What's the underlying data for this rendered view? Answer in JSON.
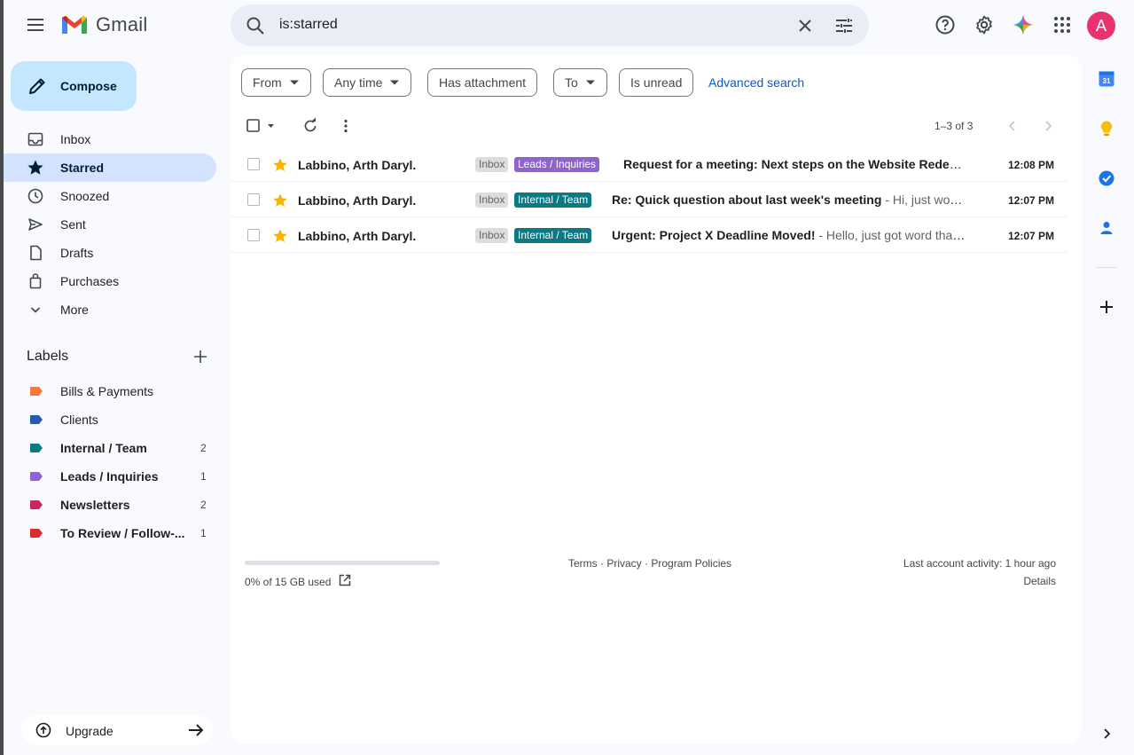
{
  "app": {
    "name": "Gmail"
  },
  "search": {
    "query": "is:starred"
  },
  "colors": {
    "accent": "#0b57d0",
    "compose_bg": "#c2e7ff",
    "active_nav": "#d3e3fd",
    "avatar": "#e8336e"
  },
  "header": {
    "avatar_letter": "A",
    "icons": [
      "help-icon",
      "settings-icon",
      "gemini-icon",
      "apps-icon"
    ]
  },
  "sidebar": {
    "compose_label": "Compose",
    "items": [
      {
        "label": "Inbox",
        "icon": "inbox-icon"
      },
      {
        "label": "Starred",
        "icon": "star-icon",
        "active": true
      },
      {
        "label": "Snoozed",
        "icon": "clock-icon"
      },
      {
        "label": "Sent",
        "icon": "send-icon"
      },
      {
        "label": "Drafts",
        "icon": "draft-icon"
      },
      {
        "label": "Purchases",
        "icon": "shopping-bag-icon"
      },
      {
        "label": "More",
        "icon": "chevron-down-icon"
      }
    ],
    "labels_title": "Labels",
    "labels": [
      {
        "label": "Bills & Payments",
        "color": "#f5793b",
        "count": "",
        "bold": false
      },
      {
        "label": "Clients",
        "color": "#285bac",
        "count": "",
        "bold": false
      },
      {
        "label": "Internal / Team",
        "color": "#0b7a82",
        "count": "2",
        "bold": true
      },
      {
        "label": "Leads / Inquiries",
        "color": "#8e63ce",
        "count": "1",
        "bold": true
      },
      {
        "label": "Newsletters",
        "color": "#c9265f",
        "count": "2",
        "bold": true
      },
      {
        "label": "To Review / Follow-...",
        "color": "#dd2c2c",
        "count": "1",
        "bold": true
      }
    ],
    "upgrade_label": "Upgrade"
  },
  "filters": {
    "chips": [
      {
        "label": "From",
        "dropdown": true
      },
      {
        "label": "Any time",
        "dropdown": true
      },
      {
        "label": "Has attachment",
        "dropdown": false
      },
      {
        "label": "To",
        "dropdown": true
      },
      {
        "label": "Is unread",
        "dropdown": false
      }
    ],
    "advanced_search": "Advanced search"
  },
  "pager": {
    "text": "1–3 of 3"
  },
  "emails": [
    {
      "sender": "Labbino, Arth Daryl.",
      "inbox_badge": "Inbox",
      "label_badge": "Leads / Inquiries",
      "label_color": "#8e63ce",
      "subject": "Request for a meeting: Next steps on the Website Redesign",
      "snippet": "",
      "time": "12:08 PM"
    },
    {
      "sender": "Labbino, Arth Daryl.",
      "inbox_badge": "Inbox",
      "label_badge": "Internal / Team",
      "label_color": "#0b7a82",
      "subject": "Re: Quick question about last week's meeting",
      "snippet": " - Hi, just wondering",
      "time": "12:07 PM"
    },
    {
      "sender": "Labbino, Arth Daryl.",
      "inbox_badge": "Inbox",
      "label_badge": "Internal / Team",
      "label_color": "#0b7a82",
      "subject": "Urgent: Project X Deadline Moved!",
      "snippet": " - Hello, just got word that the",
      "time": "12:07 PM"
    }
  ],
  "footer": {
    "storage_text": "0% of 15 GB used",
    "storage_fraction": 0,
    "terms": "Terms",
    "privacy": "Privacy",
    "policies": "Program Policies",
    "sep": " · ",
    "last_activity": "Last account activity: 1 hour ago",
    "details": "Details"
  },
  "right_sidebar": {
    "calendar_day": "31",
    "icons": [
      "calendar-icon",
      "keep-icon",
      "tasks-icon",
      "contacts-icon",
      "add-icon",
      "expand-icon"
    ]
  }
}
